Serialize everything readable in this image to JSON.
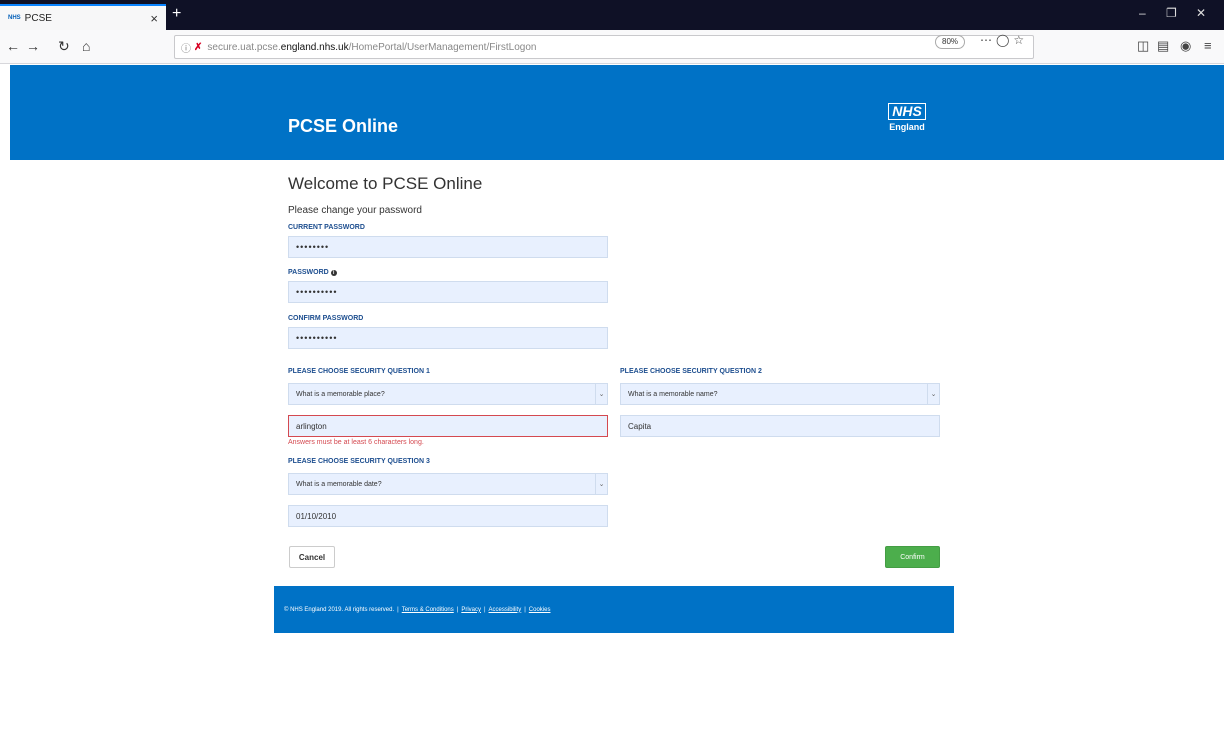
{
  "browser": {
    "tab_favicon": "NHS",
    "tab_title": "PCSE",
    "tab_close": "×",
    "new_tab": "+",
    "url_prefix": "secure.uat.pcse.",
    "url_domain": "england.nhs.uk",
    "url_path": "/HomePortal/UserManagement/FirstLogon",
    "zoom": "80%"
  },
  "header": {
    "title": "PCSE Online",
    "logo_mark": "NHS",
    "logo_sub": "England"
  },
  "form": {
    "heading": "Welcome to PCSE Online",
    "subtitle": "Please change your password",
    "current_password": {
      "label": "CURRENT PASSWORD",
      "value": "••••••••"
    },
    "password": {
      "label": "PASSWORD",
      "value": "••••••••••"
    },
    "confirm_password": {
      "label": "CONFIRM PASSWORD",
      "value": "••••••••••"
    },
    "question1": {
      "label": "PLEASE CHOOSE SECURITY QUESTION 1",
      "selected": "What is a memorable place?",
      "answer": "arlington",
      "error": "Answers must be at least 6 characters long."
    },
    "question2": {
      "label": "PLEASE CHOOSE SECURITY QUESTION 2",
      "selected": "What is a memorable name?",
      "answer": "Capita"
    },
    "question3": {
      "label": "PLEASE CHOOSE SECURITY QUESTION 3",
      "selected": "What is a memorable date?",
      "answer": "01/10/2010"
    },
    "cancel_label": "Cancel",
    "confirm_label": "Confirm"
  },
  "footer": {
    "copyright": "© NHS England 2019. All rights reserved.",
    "separator": "|",
    "links": [
      "Terms & Conditions",
      "Privacy",
      "Accessibility",
      "Cookies"
    ]
  },
  "colors": {
    "nhs_blue": "#0072c6",
    "label_blue": "#1d4e8f",
    "error_red": "#d44950",
    "confirm_green": "#4cae4c"
  }
}
